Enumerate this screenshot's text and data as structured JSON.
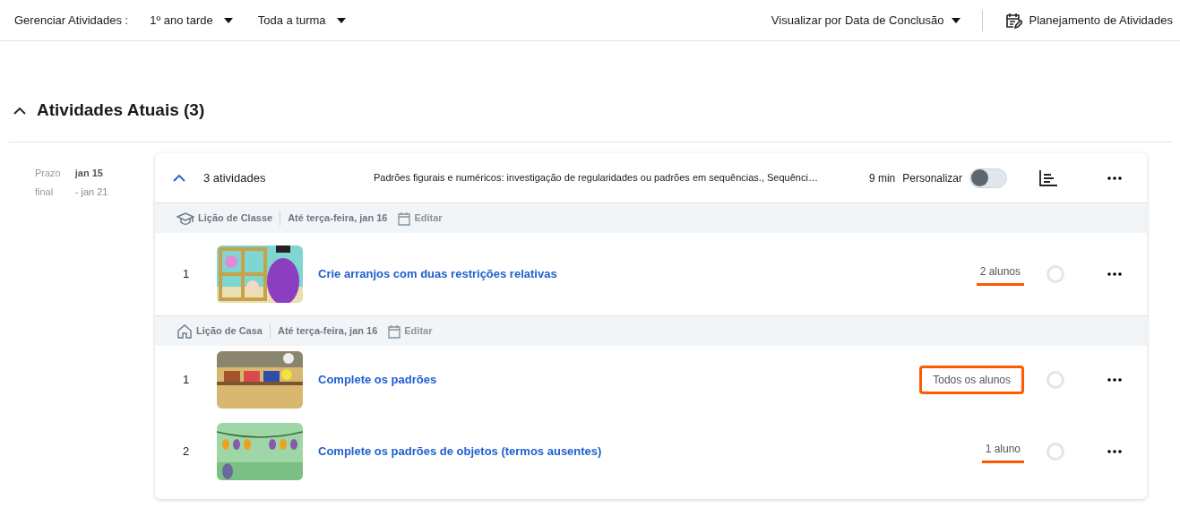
{
  "toolbar": {
    "label": "Gerenciar Atividades :",
    "dropdowns": [
      "1º ano tarde",
      "Toda a turma"
    ],
    "view": "Visualizar por Data de Conclusão",
    "planning": "Planejamento de Atividades"
  },
  "section": {
    "title": "Atividades Atuais (3)",
    "expanded": true
  },
  "due": {
    "label_1": "Prazo",
    "label_2": "final",
    "start": "jan 15",
    "end": "- jan 21"
  },
  "group": {
    "expanded": true,
    "count": "3 atividades",
    "topics": "Padrões figurais e numéricos: investigação de regularidades ou padrões em sequências., Sequênci…",
    "duration": "9 min",
    "personalize": {
      "label": "Personalizar",
      "on": false
    }
  },
  "lessons": [
    {
      "kind": "class",
      "type": "Lição de Classe",
      "due": "Até terça-feira, jan 16",
      "edit": "Editar",
      "activities": [
        {
          "number": "1",
          "title": "Crie arranjos com duas restrições relativas",
          "assigned": "2 alunos",
          "kind": "underline"
        }
      ]
    },
    {
      "kind": "home",
      "type": "Lição de Casa",
      "due": "Até terça-feira, jan 16",
      "edit": "Editar",
      "activities": [
        {
          "number": "1",
          "title": "Complete os padrões",
          "assigned": "Todos os alunos",
          "kind": "box"
        },
        {
          "number": "2",
          "title": "Complete os padrões de objetos (termos ausentes)",
          "assigned": "1 aluno",
          "kind": "underline"
        }
      ]
    }
  ]
}
